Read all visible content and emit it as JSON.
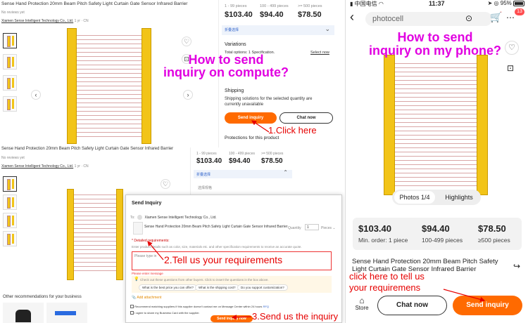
{
  "desktop_top": {
    "product_title": "Sense Hand Protection 20mm Beam Pitch Safety Light Curtain Gate Sensor Infrared Barrier",
    "reviews": "No reviews yet",
    "supplier": "Xiamen Sense Intelligent Technology Co., Ltd.",
    "supplier_meta": "1 yr · CN"
  },
  "price_panel_top": {
    "tiers": [
      {
        "range": "1 - 99 pieces",
        "price": "$103.40"
      },
      {
        "range": "100 - 499 pieces",
        "price": "$94.40"
      },
      {
        "range": ">= 500 pieces",
        "price": "$78.50"
      }
    ],
    "collapse_label": "折叠选择",
    "variations_title": "Variations",
    "variations_total": "Total options: 1 Specification.",
    "select_now": "Select now",
    "shipping_title": "Shipping",
    "shipping_text": "Shipping solutions for the selected quantity are currently unavailable",
    "send_inquiry": "Send inquiry",
    "chat_now": "Chat now",
    "protections_title": "Protections for this product"
  },
  "desktop_bottom": {
    "product_title": "Sense Hand Protection 20mm Beam Pitch Safety Light Curtain Gate Sensor Infrared Barrier",
    "reviews": "No reviews yet",
    "supplier": "Xiamen Sense Intelligent Technology Co., Ltd.",
    "supplier_meta": "1 yr · CN",
    "recommendations": "Other recommendations for your business"
  },
  "price_panel_mid": {
    "tiers": [
      {
        "range": "1 - 99 pieces",
        "price": "$103.40"
      },
      {
        "range": "100 - 499 pieces",
        "price": "$94.40"
      },
      {
        "range": ">= 500 pieces",
        "price": "$78.50"
      }
    ],
    "collapse_label": "折叠选择",
    "row_label": "选择规格"
  },
  "inquiry_dialog": {
    "title": "Send Inquiry",
    "to_label": "To:",
    "supplier": "Xiamen Sense Intelligent Technology Co., Ltd.",
    "product": "Sense Hand Protection 20mm Beam Pitch Safety Light Curtain Gate Sensor Infrared Barrier",
    "quantity_label": "Quantity",
    "quantity_value": "1",
    "unit": "Pieces",
    "detailed_label": "* Detailed requirements:",
    "detailed_hint": "Enter product details such as color, size, materials etc. and other specification requirements to receive an accurate quote.",
    "textarea_placeholder": "Please type in",
    "error_text": "Please enter message",
    "tip": "Check out these questions from other buyers. Click to insert the questions in the box above.",
    "chips": [
      "What is the best price you can offer?",
      "What is the shipping cost?",
      "Do you support customization?"
    ],
    "add_attachment": "Add attachment",
    "checkbox1": "Recommend matching suppliers if this supplier doesn't contact me on Message Center within 24 hours",
    "rfq": "RFQ",
    "checkbox2": "I agree to share my Business Card with the supplier.",
    "send_button": "Send inquiry now"
  },
  "mobile": {
    "status_carrier": "中国电信",
    "status_time": "11:37",
    "status_battery": "95%",
    "search_text": "photocell",
    "cart_badge": "13",
    "photo_tabs": [
      "Photos 1/4",
      "Highlights"
    ],
    "tiers": [
      {
        "price": "$103.40",
        "label": "Min. order: 1 piece"
      },
      {
        "price": "$94.40",
        "label": "100-499 pieces"
      },
      {
        "price": "$78.50",
        "label": "≥500 pieces"
      }
    ],
    "title": "Sense Hand Protection 20mm Beam Pitch Safety Light Curtain Gate Sensor Infrared Barrier",
    "store_label": "Store",
    "chat_now": "Chat now",
    "send_inquiry": "Send inquiry"
  },
  "annotations": {
    "computer_heading": "How to send\ninquiry on compute?",
    "phone_heading": "How to send\ninquiry on my phone?",
    "step1": "1.Click here",
    "step2": "2.Tell us your requirements",
    "step3": "3.Send us the inquiry",
    "mobile_hint": "click here to tell us\nyour requiremens"
  },
  "colors": {
    "accent": "#ff6a00",
    "annotation": "#e100e1",
    "arrow": "#e60000",
    "curtain": "#f2c418"
  }
}
